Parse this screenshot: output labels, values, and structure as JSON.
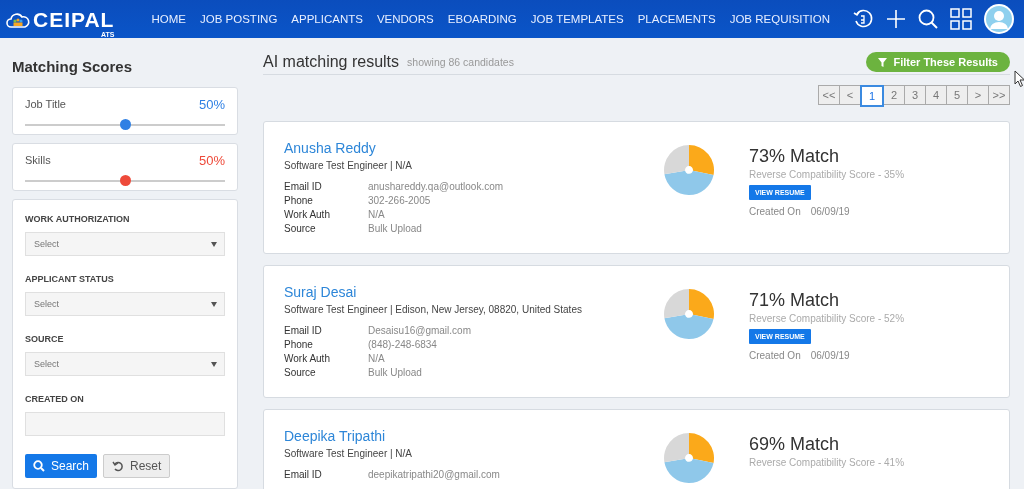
{
  "header": {
    "logo": "CEIPAL",
    "logo_sub": "ATS",
    "nav": [
      {
        "label": "HOME"
      },
      {
        "label": "JOB POSTING"
      },
      {
        "label": "APPLICANTS"
      },
      {
        "label": "VENDORS"
      },
      {
        "label": "EBOARDING"
      },
      {
        "label": "JOB TEMPLATES"
      },
      {
        "label": "PLACEMENTS"
      },
      {
        "label": "JOB REQUISITION"
      }
    ]
  },
  "sidebar": {
    "title": "Matching Scores",
    "scores": [
      {
        "label": "Job Title",
        "value": "50%",
        "level": 0.5,
        "color": "#2f80e4"
      },
      {
        "label": "Skills",
        "value": "50%",
        "level": 0.5,
        "color": "#ee4a3a"
      }
    ],
    "filters": [
      {
        "label": "WORK AUTHORIZATION",
        "kind": "select",
        "placeholder": "Select"
      },
      {
        "label": "APPLICANT STATUS",
        "kind": "select",
        "placeholder": "Select"
      },
      {
        "label": "SOURCE",
        "kind": "select",
        "placeholder": "Select"
      },
      {
        "label": "CREATED ON",
        "kind": "input"
      }
    ],
    "buttons": [
      {
        "label": "Search",
        "kind": "primary"
      },
      {
        "label": "Reset",
        "kind": "secondary"
      }
    ]
  },
  "results": {
    "title": "AI matching results",
    "subtitle": "showing 86 candidates",
    "filter_button": "Filter These Results",
    "pagination": [
      {
        "label": "<<",
        "selected": false
      },
      {
        "label": "<",
        "selected": false
      },
      {
        "label": "1",
        "selected": true
      },
      {
        "label": "2",
        "selected": false
      },
      {
        "label": "3",
        "selected": false
      },
      {
        "label": "4",
        "selected": false
      },
      {
        "label": "5",
        "selected": false
      },
      {
        "label": ">",
        "selected": false
      },
      {
        "label": ">>",
        "selected": false
      }
    ],
    "candidates": [
      {
        "name": "Anusha Reddy",
        "headline": "Software Test Engineer | N/A",
        "fields": [
          {
            "label": "Email ID",
            "value": "anushareddy.qa@outlook.com"
          },
          {
            "label": "Phone",
            "value": "302-266-2005"
          },
          {
            "label": "Work Auth",
            "value": "N/A"
          },
          {
            "label": "Source",
            "value": "Bulk Upload"
          }
        ],
        "match": "73% Match",
        "reverse_score": "Reverse Compatibility Score - 35%",
        "view_resume": "VIEW RESUME",
        "created_label": "Created On",
        "created_value": "06/09/19"
      },
      {
        "name": "Suraj Desai",
        "headline": "Software Test Engineer | Edison, New Jersey, 08820, United States",
        "fields": [
          {
            "label": "Email ID",
            "value": "Desaisu16@gmail.com"
          },
          {
            "label": "Phone",
            "value": "(848)-248-6834"
          },
          {
            "label": "Work Auth",
            "value": "N/A"
          },
          {
            "label": "Source",
            "value": "Bulk Upload"
          }
        ],
        "match": "71% Match",
        "reverse_score": "Reverse Compatibility Score - 52%",
        "view_resume": "VIEW RESUME",
        "created_label": "Created On",
        "created_value": "06/09/19"
      },
      {
        "name": "Deepika Tripathi",
        "headline": "Software Test Engineer | N/A",
        "fields": [
          {
            "label": "Email ID",
            "value": "deepikatripathi20@gmail.com"
          }
        ],
        "match": "69% Match",
        "reverse_score": "Reverse Compatibility Score - 41%"
      }
    ]
  }
}
